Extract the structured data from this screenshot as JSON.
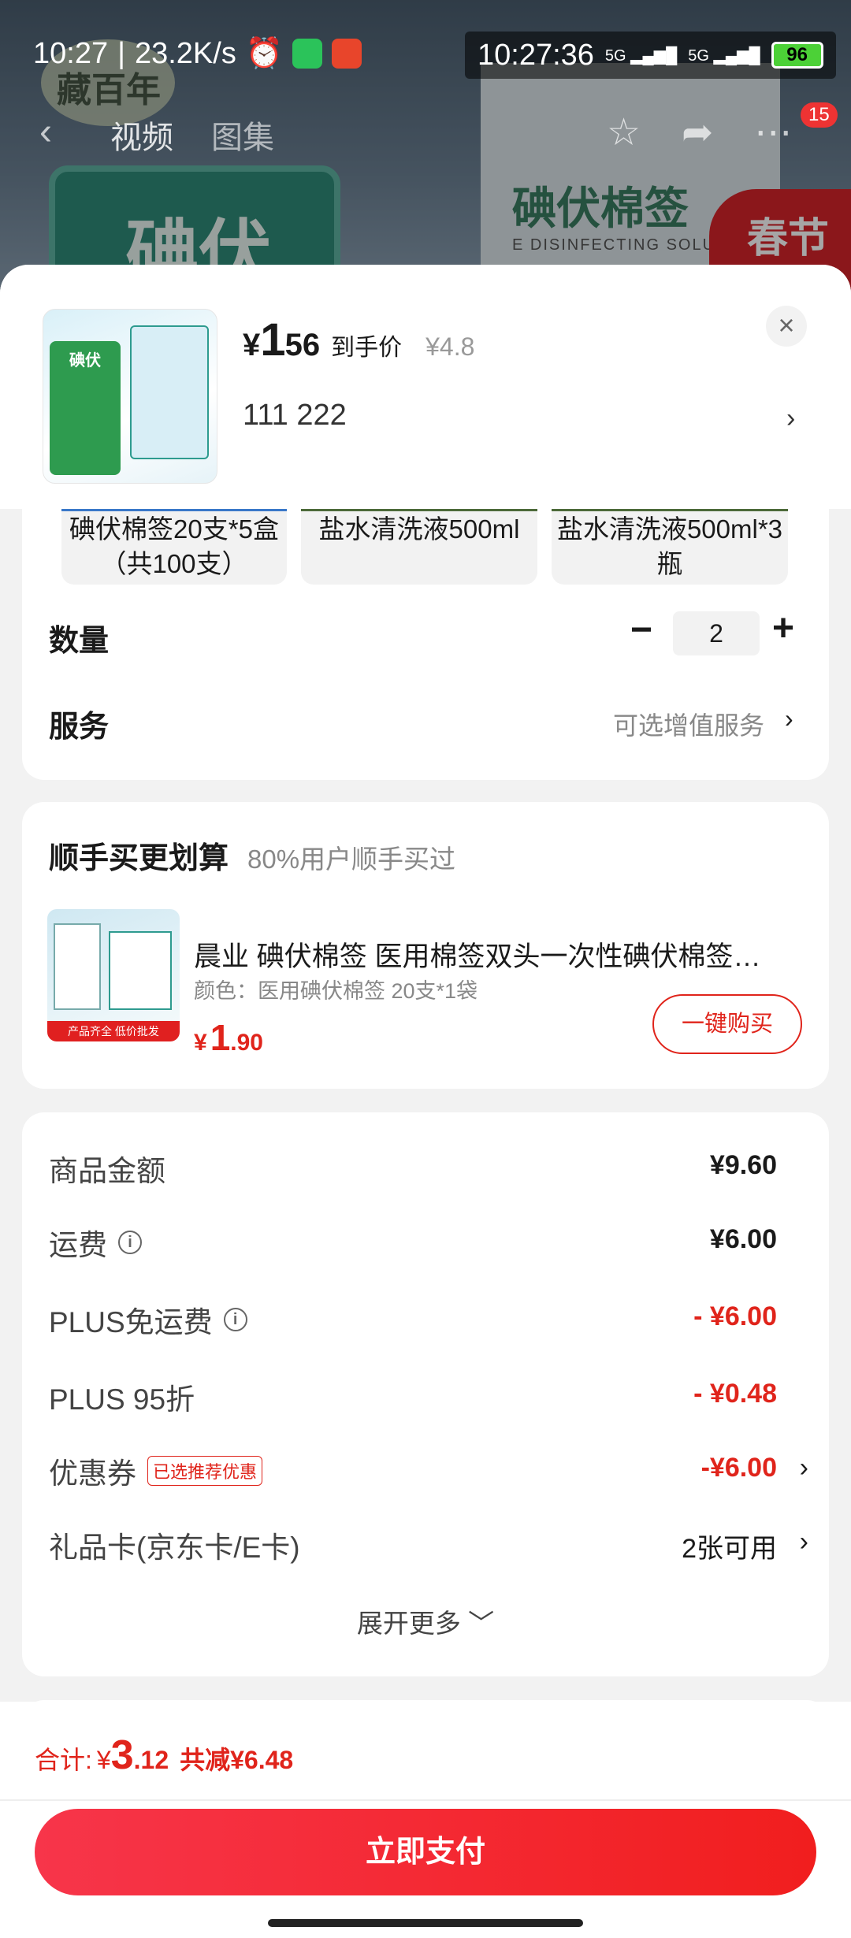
{
  "status_bar": {
    "time": "10:27",
    "net_speed": "23.2K/s",
    "overlay_time": "10:27:36",
    "battery": "96",
    "signal1": "5G",
    "signal2": "5G"
  },
  "nav": {
    "tab_video": "视频",
    "tab_gallery": "图集",
    "badge": "15"
  },
  "background": {
    "box_text": "碘伏",
    "package_title": "碘伏棉签",
    "package_sub": "E DISINFECTING SOLUTION",
    "brand": "藏百年",
    "promo": "春节"
  },
  "product": {
    "price_symbol": "¥",
    "price_int": "1",
    "price_dec": ".56",
    "price_tag": "到手价",
    "old_price": "¥4.8",
    "spec": "111  222",
    "thumb_label": "碘伏"
  },
  "options": [
    {
      "label": "碘伏棉签20支*5盒（共100支）"
    },
    {
      "label": "盐水清洗液500ml"
    },
    {
      "label": "盐水清洗液500ml*3瓶"
    }
  ],
  "quantity": {
    "label": "数量",
    "value": "2"
  },
  "service": {
    "label": "服务",
    "value": "可选增值服务"
  },
  "addon": {
    "title": "顺手买更划算",
    "subtitle": "80%用户顺手买过",
    "name": "晨业 碘伏棉签 医用棉签双头一次性碘伏棉签…",
    "spec": "颜色：医用碘伏棉签  20支*1袋",
    "price_symbol": "¥",
    "price_int": "1",
    "price_dec": ".90",
    "button": "一键购买",
    "thumb_banner": "产品齐全 低价批发"
  },
  "summary": {
    "rows": [
      {
        "label": "商品金额",
        "value": "¥9.60"
      },
      {
        "label": "运费",
        "value": "¥6.00"
      },
      {
        "label": "PLUS免运费",
        "value": "- ¥6.00"
      },
      {
        "label": "PLUS 95折",
        "value": "- ¥0.48"
      },
      {
        "label": "优惠券",
        "tag": "已选推荐优惠",
        "value": "-¥6.00"
      },
      {
        "label": "礼品卡(京东卡/E卡)",
        "value": "2张可用"
      }
    ],
    "expand": "展开更多"
  },
  "footer": {
    "total_label": "合计:",
    "total_symbol": "¥",
    "total_int": "3",
    "total_dec": ".12",
    "discount": "共减¥6.48",
    "pay_button": "立即支付"
  },
  "colors": {
    "accent_red": "#e0241b",
    "pay_gradient_start": "#f7354a",
    "pay_gradient_end": "#f11e1e"
  }
}
